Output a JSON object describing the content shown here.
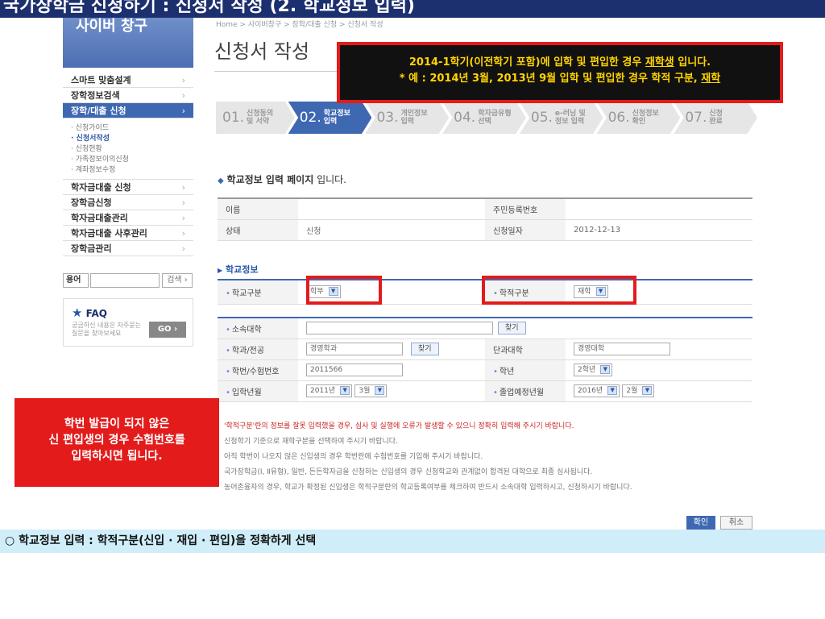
{
  "slide_title": "국가장학금 신청하기 : 신청서 작성 (2. 학교정보 입력)",
  "sidebar": {
    "header": "사이버 창구",
    "items_top": [
      {
        "label": "스마트 맞춤설계"
      },
      {
        "label": "장학정보검색"
      },
      {
        "label": "장학/대출 신청"
      }
    ],
    "sub_items": [
      "· 신청가이드",
      "· 신청서작성",
      "· 신청현황",
      "· 가족정보이의신청",
      "· 계좌정보수정"
    ],
    "items_bottom": [
      {
        "label": "학자금대출 신청"
      },
      {
        "label": "장학금신청"
      },
      {
        "label": "학자금대출관리"
      },
      {
        "label": "학자금대출 사후관리"
      },
      {
        "label": "장학금관리"
      }
    ],
    "arrow": "›",
    "term_label": "용어",
    "term_button": "검색 ›",
    "faq_title": "FAQ",
    "faq_desc": "궁금하신 내용은 자주묻는 질문을 찾아보세요",
    "faq_go": "GO ›"
  },
  "breadcrumb": "Home > 사이버창구 > 장학/대출 신청 > 신청서 작성",
  "page_title": "신청서 작성",
  "steps": [
    {
      "num": "01.",
      "label": "신청동의\n및 서약"
    },
    {
      "num": "02.",
      "label": "학교정보\n입력"
    },
    {
      "num": "03.",
      "label": "개인정보\n입력"
    },
    {
      "num": "04.",
      "label": "학자금유형\n선택"
    },
    {
      "num": "05.",
      "label": "e-러닝 및\n정보 입력"
    },
    {
      "num": "06.",
      "label": "신청정보\n확인"
    },
    {
      "num": "07.",
      "label": "신청\n완료"
    }
  ],
  "info_heading": {
    "bold": "학교정보 입력 페이지",
    "rest": " 입니다."
  },
  "basic": {
    "name_label": "이름",
    "name_value": "",
    "rrn_label": "주민등록번호",
    "rrn_value": "",
    "status_label": "상태",
    "status_value": "신청",
    "date_label": "신청일자",
    "date_value": "2012-12-13"
  },
  "school_section": "학교정보",
  "school": {
    "school_type_label": "학교구분",
    "school_type_value": "학부",
    "enroll_type_label": "학적구분",
    "enroll_type_value": "재학",
    "university_label": "소속대학",
    "university_value": "",
    "find_button": "찾기",
    "major_label": "학과/전공",
    "major_value": "경영학과",
    "college_label": "단과대학",
    "college_value": "경영대학",
    "student_id_label": "학번/수험번호",
    "student_id_value": "2011566",
    "grade_label": "학년",
    "grade_value": "2학년",
    "entry_label": "입학년월",
    "entry_year": "2011년",
    "entry_month": "3월",
    "grad_label": "졸업예정년월",
    "grad_year": "2016년",
    "grad_month": "2월"
  },
  "notes": [
    "'학적구분'란의 정보를 잘못 입력했을 경우, 심사 및 실행에 오류가 발생할 수 있으니 정확히 입력해 주시기 바랍니다.",
    "신청학기 기준으로 재학구분을 선택하여 주시기 바랍니다.",
    "아직 학번이 나오지 않은 신입생의 경우 학번란에 수험번호를 기입해 주시기 바랍니다.",
    "국가장학금(Ⅰ, Ⅱ유형), 일반, 든든학자금을 신청하는 신입생의 경우 신청학교와 관계없이 합격된 대학으로 최종 심사됩니다.",
    "농어촌융자의 경우, 학교가 확정된 신입생은 학적구분란의 학교등록여부를 체크하여 반드시 소속대학 입력하시고, 신청하시기 바랍니다."
  ],
  "buttons": {
    "ok": "확인",
    "cancel": "취소"
  },
  "callout_top": {
    "line1_pre": "2014-1학기(이전학기 포함)에 입학 및 편입한 경우 ",
    "line1_u": "재학생",
    "line1_post": " 입니다.",
    "line2_pre": "* 예 : 2014년 3월, 2013년 9월 입학 및 편입한 경우 학적 구분, ",
    "line2_u": "재학"
  },
  "callout_left": [
    "학번 발급이 되지 않은",
    "신 편입생의 경우 수험번호를",
    "입력하시면 됩니다."
  ],
  "bottom_caption": "○ 학교정보 입력 : 학적구분(신입 · 재입 · 편입)을 정확하게 선택",
  "icons": {
    "dropdown": "▼",
    "diamond": "◆",
    "triangle": "▶",
    "star": "★"
  },
  "colors": {
    "accent": "#3f68b3",
    "highlight": "#e31b1b",
    "callout_text": "#ffd400"
  }
}
